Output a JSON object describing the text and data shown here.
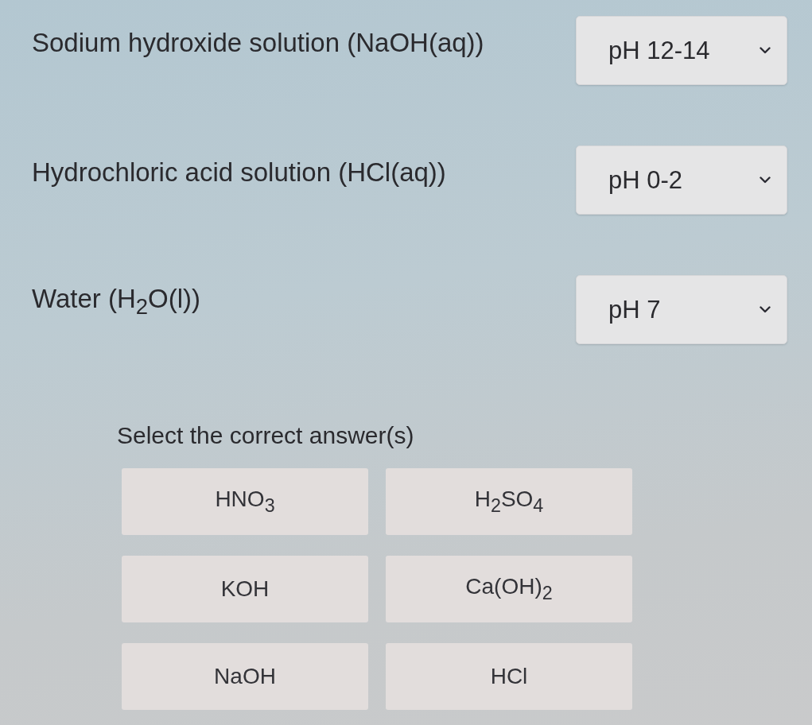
{
  "matches": [
    {
      "label": "Sodium hydroxide solution (NaOH(aq))",
      "value": "pH 12-14"
    },
    {
      "label": "Hydrochloric acid solution (HCl(aq))",
      "value": "pH 0-2"
    },
    {
      "label": "Water (H$_{2}$O(l))",
      "value": "pH 7"
    }
  ],
  "question": {
    "prompt": "Select the correct answer(s)",
    "options": [
      {
        "label": "HNO$_{3}$",
        "selected": false
      },
      {
        "label": "H$_{2}$SO$_{4}$",
        "selected": false
      },
      {
        "label": "KOH",
        "selected": false
      },
      {
        "label": "Ca(OH)$_{2}$",
        "selected": false
      },
      {
        "label": "NaOH",
        "selected": false
      },
      {
        "label": "HCl",
        "selected": false
      }
    ]
  }
}
